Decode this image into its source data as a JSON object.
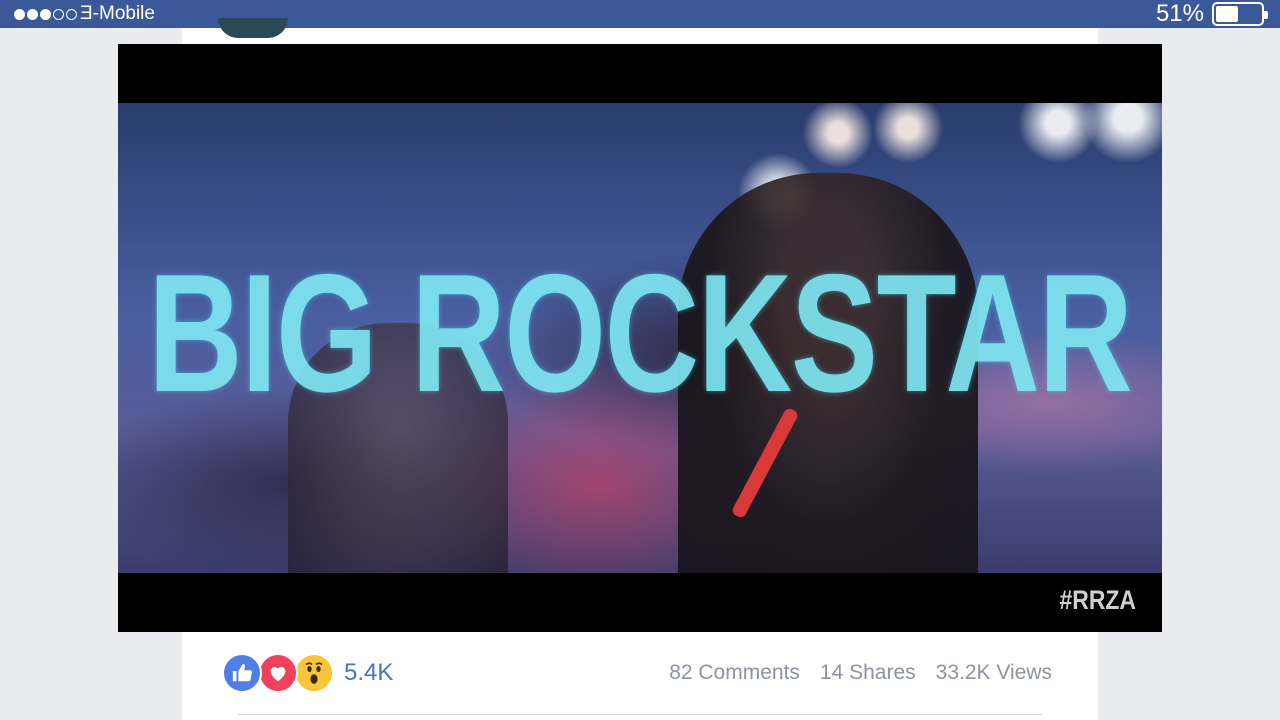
{
  "status_bar": {
    "signal_dots": [
      "on",
      "on",
      "on",
      "off",
      "off"
    ],
    "carrier": "Ǝ-Mobile",
    "battery_percent": "51%",
    "battery_level": 0.51,
    "background": "#3b5998"
  },
  "video": {
    "headline": "BIG ROCKSTAR",
    "hashtag": "#RRZA"
  },
  "reactions": {
    "icons": [
      "like-icon",
      "love-icon",
      "wow-icon"
    ],
    "count": "5.4K"
  },
  "stats": {
    "comments": "82 Comments",
    "shares": "14 Shares",
    "views": "33.2K Views"
  },
  "colors": {
    "brand": "#3b5998",
    "link_blue": "#4a72c9",
    "muted_text": "#8d949e"
  }
}
